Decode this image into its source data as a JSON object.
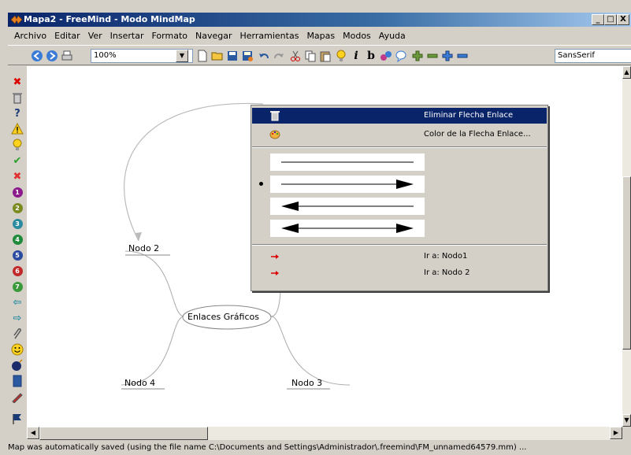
{
  "window": {
    "title": "Mapa2 - FreeMind - Modo MindMap",
    "controls": [
      "_",
      "□",
      "X"
    ]
  },
  "menu": [
    "Archivo",
    "Editar",
    "Ver",
    "Insertar",
    "Formato",
    "Navegar",
    "Herramientas",
    "Mapas",
    "Modos",
    "Ayuda"
  ],
  "toolbar": {
    "zoom_value": "100%",
    "font_value": "SansSerif"
  },
  "map": {
    "root": "Enlaces Gráficos",
    "nodes": [
      "Nodo 2",
      "Nodo 4",
      "Nodo 3"
    ]
  },
  "context_menu": {
    "items": [
      {
        "label": "Eliminar Flecha Enlace",
        "icon": "trash-icon"
      },
      {
        "label": "Color de la Flecha Enlace...",
        "icon": "palette-icon"
      }
    ],
    "arrow_styles": [
      "none",
      "end",
      "start",
      "both"
    ],
    "selected_arrow_style": "end",
    "goto_items": [
      {
        "label": "Ir a: Nodo1",
        "icon": "red-arrow-icon"
      },
      {
        "label": "Ir a: Nodo 2",
        "icon": "red-arrow-icon"
      }
    ]
  },
  "status": "Map was automatically saved (using the file name C:\\Documents and Settings\\Administrador\\.freemind\\FM_unnamed64579.mm) ...",
  "colors": {
    "title_active": "#0a246a",
    "menu_selection": "#0a246a",
    "link_arrow": "#bbbbbb"
  }
}
